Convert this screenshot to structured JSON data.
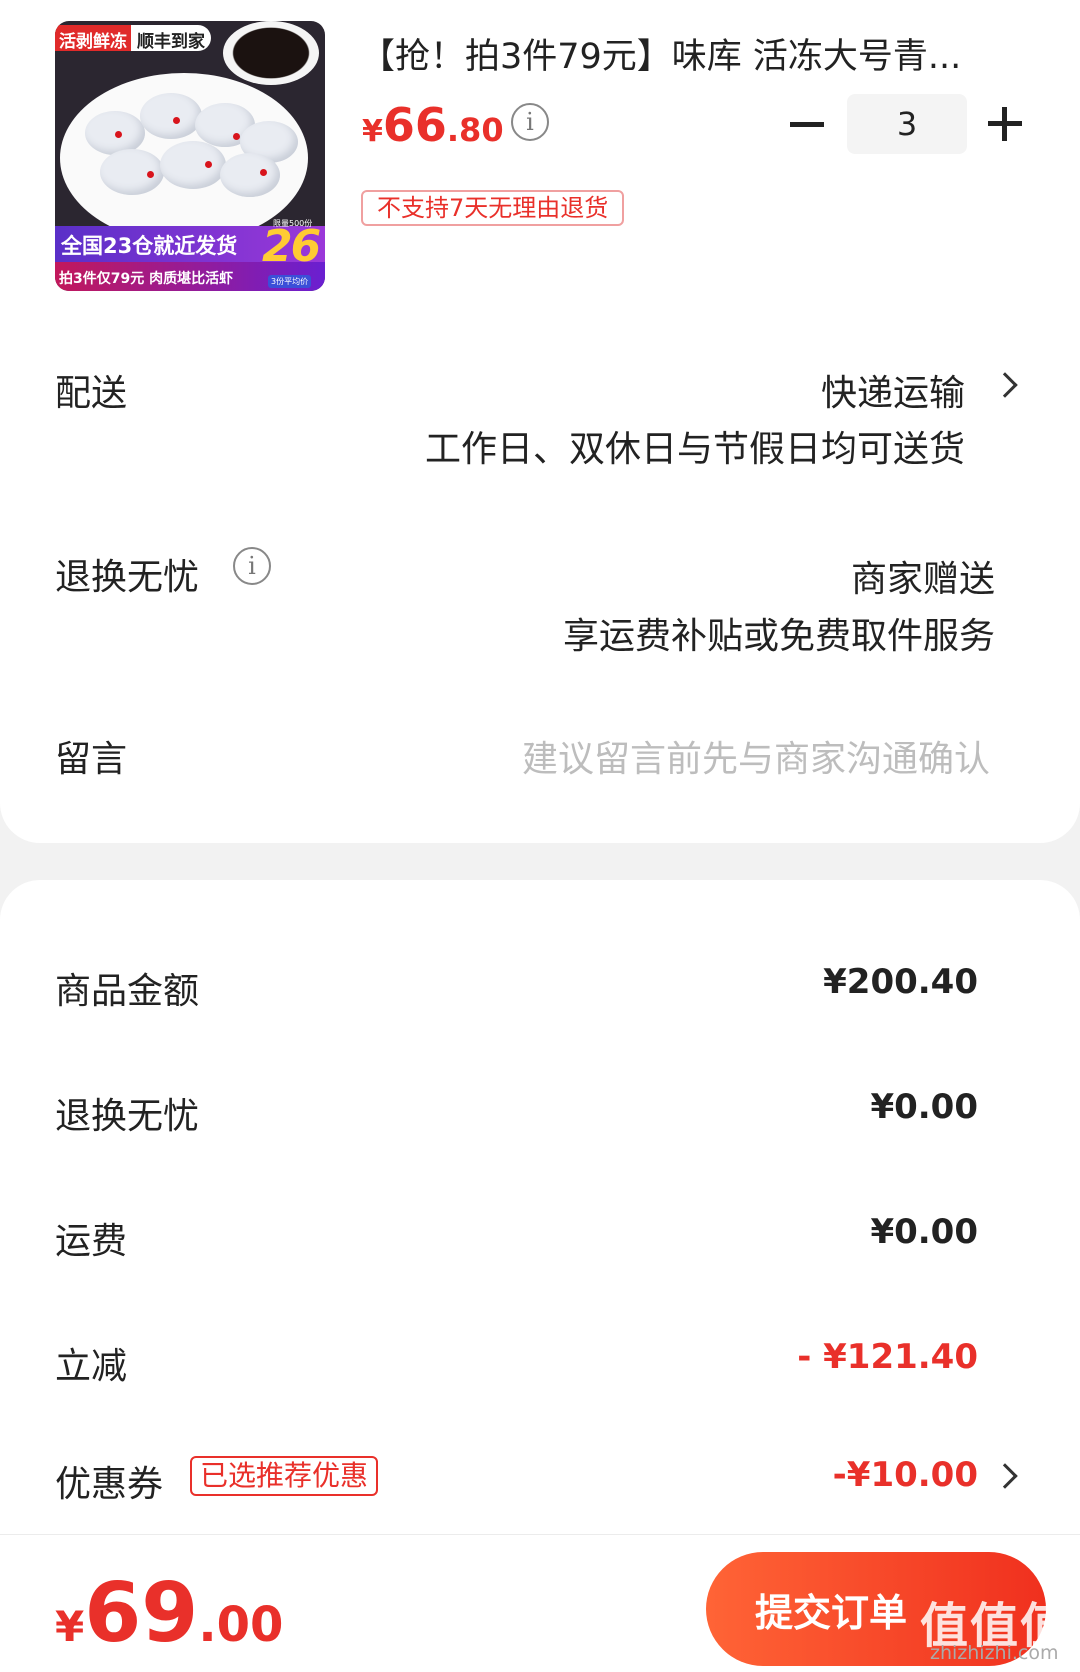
{
  "product": {
    "title": "【抢！拍3件79元】味库 活冻大号青...",
    "price_symbol": "¥",
    "price_int": "66",
    "price_dec": ".80",
    "quantity": "3",
    "no_return_tag": "不支持7天无理由退货",
    "image": {
      "top_tag_red": "活剥鲜冻",
      "top_tag_white": "顺丰到家",
      "promo_line1": "全国23仓就近发货",
      "promo_line2": "拍3件仅79元 肉质堪比活虾",
      "big_number": "26",
      "note_top": "限量500份",
      "note_bottom": "3份平均价"
    }
  },
  "delivery": {
    "label": "配送",
    "method": "快递运输",
    "detail": "工作日、双休日与节假日均可送货"
  },
  "return_service": {
    "label": "退换无忧",
    "value": "商家赠送",
    "detail": "享运费补贴或免费取件服务"
  },
  "message": {
    "label": "留言",
    "placeholder": "建议留言前先与商家沟通确认"
  },
  "summary": {
    "goods_label": "商品金额",
    "goods_value": "¥200.40",
    "return_label": "退换无忧",
    "return_value": "¥0.00",
    "shipping_label": "运费",
    "shipping_value": "¥0.00",
    "discount_label": "立减",
    "discount_value": "- ¥121.40",
    "coupon_label": "优惠券",
    "coupon_tag": "已选推荐优惠",
    "coupon_value": "-¥10.00"
  },
  "footer": {
    "total_symbol": "¥",
    "total_int": "69",
    "total_dec": ".00",
    "submit_label": "提交订单",
    "watermark": "值值值",
    "watermark_url": "zhizhizhi.com"
  },
  "colors": {
    "accent_red": "#e9302a",
    "button_gradient_start": "#ff6436",
    "button_gradient_end": "#f0301e",
    "placeholder_gray": "#bdbdbd",
    "page_bg": "#f2f2f2"
  },
  "icons": [
    "info-icon",
    "minus-icon",
    "plus-icon",
    "chevron-right-icon"
  ]
}
